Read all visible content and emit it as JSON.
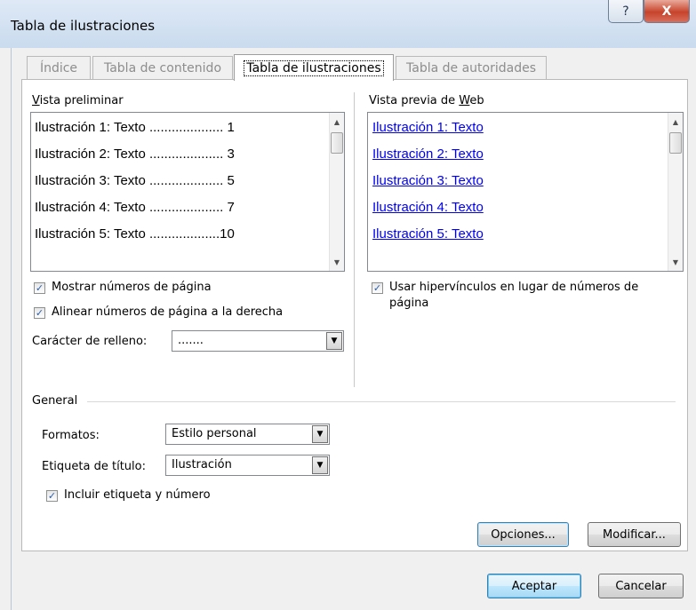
{
  "window": {
    "title": "Tabla de ilustraciones",
    "help_glyph": "?",
    "close_glyph": "X"
  },
  "tabs": [
    {
      "label": "Índice",
      "active": false
    },
    {
      "label": "Tabla de contenido",
      "active": false
    },
    {
      "label": "Tabla de ilustraciones",
      "active": true
    },
    {
      "label": "Tabla de autoridades",
      "active": false
    }
  ],
  "print_preview": {
    "label": "Vista preliminar",
    "items": [
      "Ilustración 1: Texto .................... 1",
      "Ilustración 2: Texto .................... 3",
      "Ilustración 3: Texto .................... 5",
      "Ilustración 4: Texto .................... 7",
      "Ilustración 5: Texto ...................10"
    ]
  },
  "web_preview": {
    "label": "Vista previa de Web",
    "items": [
      "Ilustración 1: Texto",
      "Ilustración 2: Texto",
      "Ilustración 3: Texto",
      "Ilustración 4: Texto",
      "Ilustración 5: Texto"
    ]
  },
  "options": {
    "show_page_numbers": {
      "label": "Mostrar números de página",
      "checked": true
    },
    "right_align": {
      "label": "Alinear números de página a la derecha",
      "checked": true
    },
    "tab_leader": {
      "label": "Carácter de relleno:",
      "value": "......."
    },
    "use_hyperlinks": {
      "label_line1": "Usar hipervínculos en lugar de números de",
      "label_line2": "página",
      "checked": true
    }
  },
  "general": {
    "label": "General",
    "formats": {
      "label": "Formatos:",
      "value": "Estilo personal"
    },
    "caption_label": {
      "label": "Etiqueta de título:",
      "value": "Ilustración"
    },
    "include_label": {
      "label": "Incluir etiqueta y número",
      "checked": true
    }
  },
  "buttons": {
    "options": "Opciones...",
    "modify": "Modificar...",
    "ok": "Aceptar",
    "cancel": "Cancelar"
  },
  "icons": {
    "check": "✓",
    "up_arrow": "▲",
    "down_arrow": "▼"
  }
}
